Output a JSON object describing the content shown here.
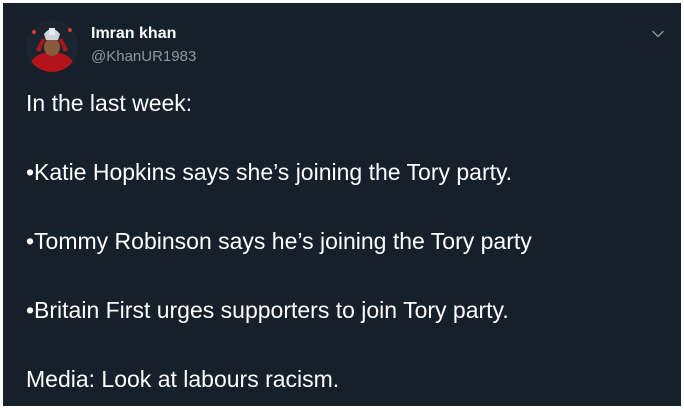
{
  "tweet": {
    "author": {
      "name": "Imran khan",
      "handle": "@KhanUR1983"
    },
    "lines": [
      "In the last week:",
      "•Katie Hopkins says she’s joining the Tory party.",
      "•Tommy Robinson says he’s joining the Tory party",
      "•Britain First urges supporters to join Tory party.",
      "Media: Look at labours racism."
    ]
  },
  "icons": {
    "avatar": "profile-photo",
    "menu": "chevron-down-icon"
  },
  "colors": {
    "background": "#15202b",
    "text_primary": "#ffffff",
    "text_secondary": "#8899a6"
  }
}
